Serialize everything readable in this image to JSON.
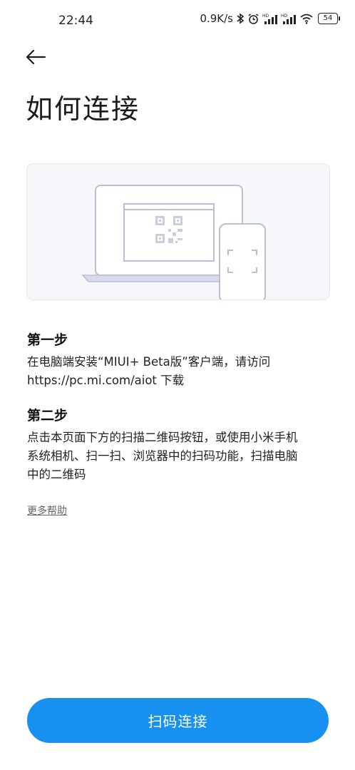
{
  "status_bar": {
    "time": "22:44",
    "network_speed": "0.9K/s",
    "battery_level": "54",
    "icons": [
      "bluetooth-icon",
      "alarm-icon",
      "signal-hd-icon",
      "signal-hd-icon",
      "wifi-icon",
      "battery-icon"
    ]
  },
  "header": {
    "back_icon": "arrow-left-icon",
    "title": "如何连接"
  },
  "illustration": {
    "depicts": [
      "laptop-icon",
      "qr-code-icon",
      "phone-scanner-icon"
    ],
    "colors": {
      "stroke": "#b9bfd6",
      "background": "#f6f7fb"
    }
  },
  "steps": [
    {
      "title": "第一步",
      "lines": [
        "在电脑端安装“MIUI+ Beta版”客户端，请访问",
        "https://pc.mi.com/aiot 下载"
      ]
    },
    {
      "title": "第二步",
      "lines": [
        "点击本页面下方的扫描二维码按钮，或使用小米手机",
        "系统相机、扫一扫、浏览器中的扫码功能，扫描电脑",
        "中的二维码"
      ]
    }
  ],
  "help_link": "更多帮助",
  "primary_button": {
    "label": "扫码连接",
    "color": "#1890f0"
  }
}
